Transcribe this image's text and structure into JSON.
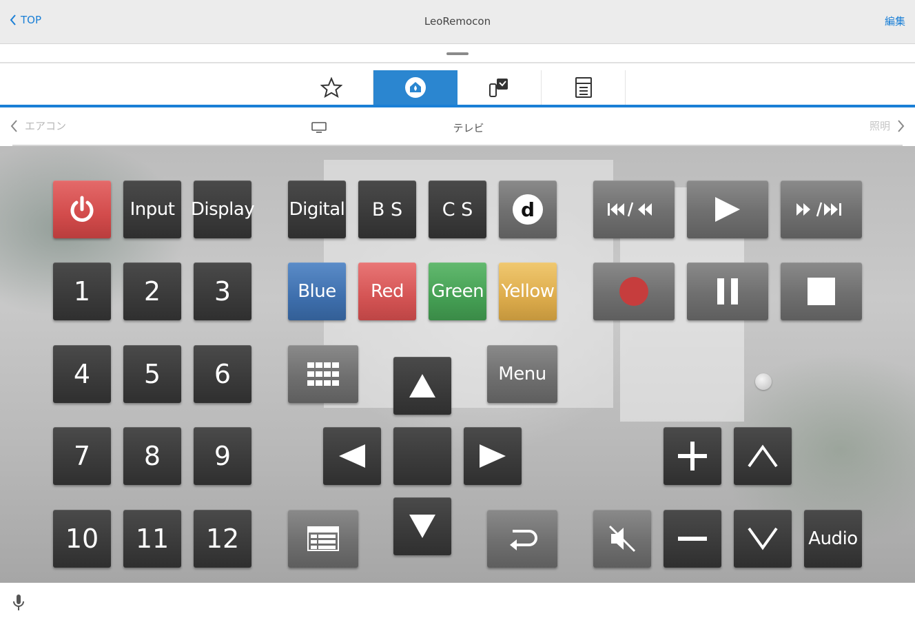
{
  "header": {
    "back_label": "TOP",
    "title": "LeoRemocon",
    "edit_label": "編集"
  },
  "device_nav": {
    "prev_label": "エアコン",
    "current_label": "テレビ",
    "next_label": "照明"
  },
  "remote": {
    "power": "power-icon",
    "input": "Input",
    "display": "Display",
    "digital": "Digital",
    "bs": "B S",
    "cs": "C S",
    "d": "d",
    "rewind": "⏮/⏪",
    "play": "play-icon",
    "forward": "⏩/⏭",
    "numbers": [
      "1",
      "2",
      "3",
      "4",
      "5",
      "6",
      "7",
      "8",
      "9",
      "10",
      "11",
      "12"
    ],
    "blue": "Blue",
    "red": "Red",
    "green": "Green",
    "yellow": "Yellow",
    "menu": "Menu",
    "audio": "Audio"
  },
  "colors": {
    "accent": "#1a7fd6",
    "power": "#d24b4b",
    "blue": "#3e6fad",
    "red": "#d45454",
    "green": "#45a054",
    "yellow": "#ddac4c"
  }
}
